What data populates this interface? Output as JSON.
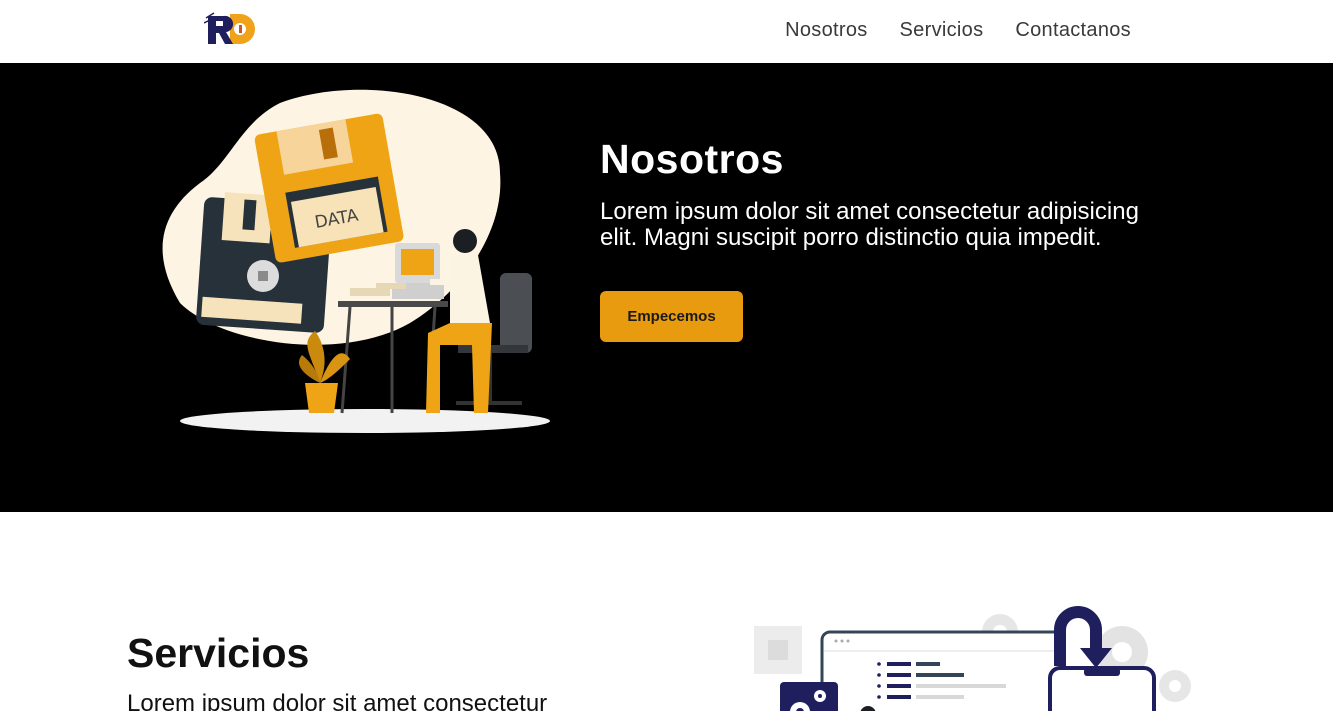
{
  "brand": {
    "logo_text": "RD"
  },
  "nav": {
    "items": [
      {
        "label": "Nosotros"
      },
      {
        "label": "Servicios"
      },
      {
        "label": "Contactanos"
      }
    ]
  },
  "hero": {
    "title": "Nosotros",
    "text": "Lorem ipsum dolor sit amet consectetur adipisicing elit. Magni suscipit porro distinctio quia impedit.",
    "button_label": "Empecemos",
    "illustration_label": "DATA"
  },
  "services": {
    "title": "Servicios",
    "text": "Lorem ipsum dolor sit amet consectetur"
  },
  "colors": {
    "accent": "#e89b0e",
    "hero_bg": "#000000",
    "navy": "#1e1f5c"
  }
}
